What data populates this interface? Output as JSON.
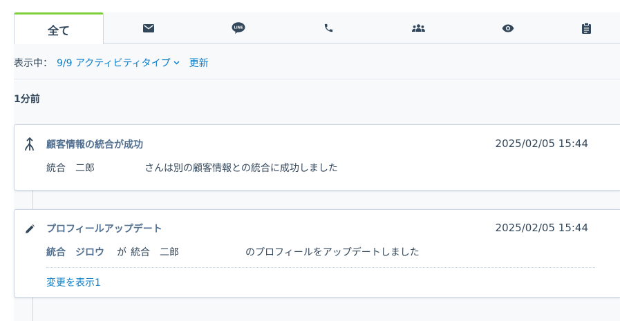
{
  "tabs": {
    "all_label": "全て",
    "items": [
      "email-icon",
      "line-icon",
      "phone-icon",
      "meeting-icon",
      "view-icon",
      "task-icon"
    ]
  },
  "filter": {
    "showing_label": "表示中：",
    "activity_types": "9/9 アクティビティタイプ",
    "refresh_label": "更新"
  },
  "group": {
    "heading": "1分前"
  },
  "activities": [
    {
      "icon": "merge-icon",
      "title": "顧客情報の統合が成功",
      "timestamp": "2025/02/05 15:44",
      "contact": "統合　二郎",
      "message": "さんは別の顧客情報との統合に成功しました"
    },
    {
      "icon": "pencil-icon",
      "title": "プロフィールアップデート",
      "timestamp": "2025/02/05 15:44",
      "actor": "統合　ジロウ",
      "connector": "が",
      "contact": "統合　二郎",
      "message": "のプロフィールをアップデートしました",
      "show_changes": "変更を表示1"
    }
  ],
  "colors": {
    "active_tab_accent": "#7fd13b",
    "link": "#0b7ec9",
    "text": "#33475b",
    "muted_bold": "#516f90",
    "border": "#cbd6e2"
  }
}
